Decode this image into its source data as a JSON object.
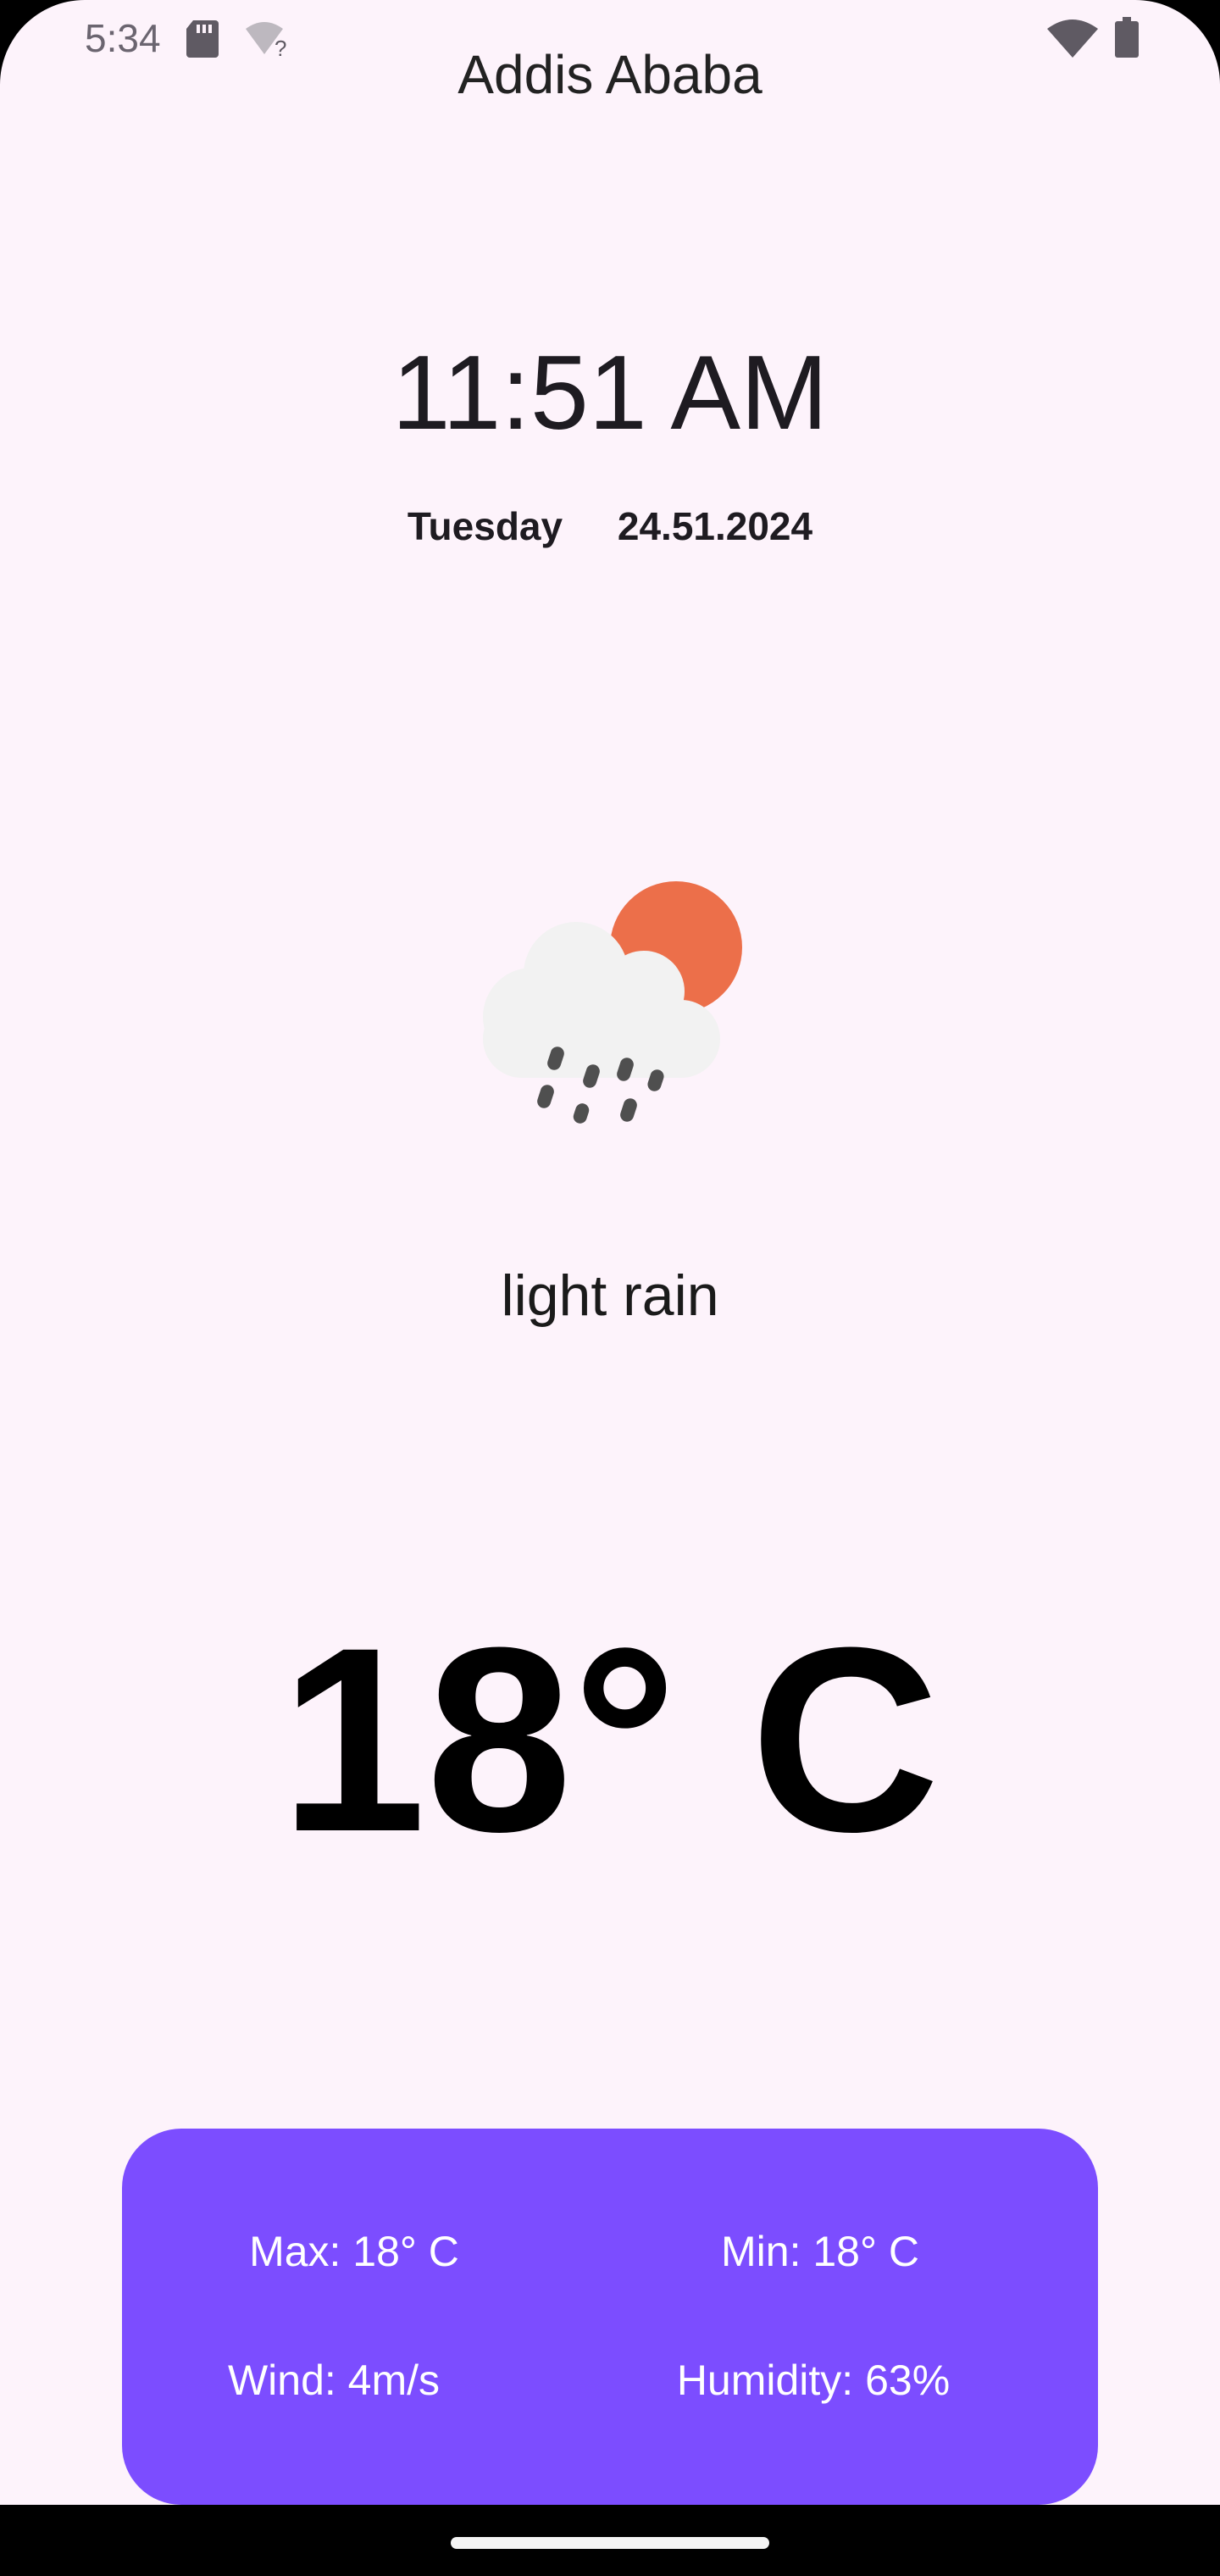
{
  "status_bar": {
    "time": "5:34",
    "icons": [
      "sd-card-icon",
      "wifi-question-icon",
      "wifi-icon",
      "battery-icon"
    ]
  },
  "location": {
    "city": "Addis Ababa"
  },
  "clock": {
    "time": "11:51 AM",
    "day": "Tuesday",
    "date": "24.51.2024"
  },
  "weather": {
    "icon": "cloud-sun-rain-icon",
    "description": "light rain",
    "temperature": "18° C"
  },
  "details": {
    "max": "Max: 18° C",
    "min": "Min: 18° C",
    "wind": "Wind: 4m/s",
    "humidity": "Humidity: 63%"
  },
  "colors": {
    "background": "#fdf3fb",
    "card": "#7c4dff",
    "sun": "#ec6f4a",
    "cloud": "#f2f2f2",
    "rain": "#4f4f4f"
  }
}
